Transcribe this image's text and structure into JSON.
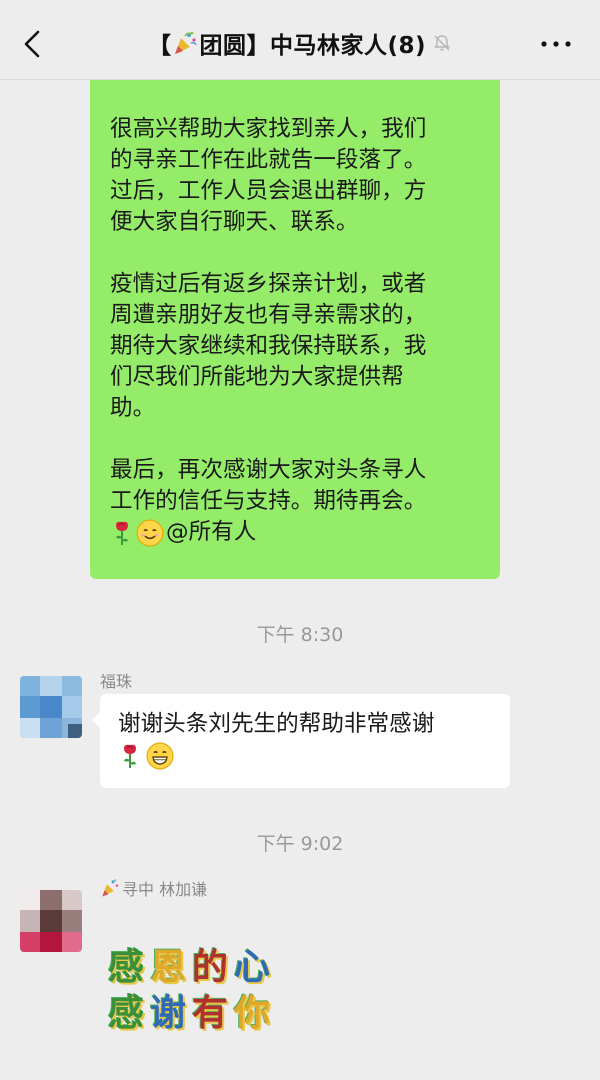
{
  "header": {
    "title_prefix": "【",
    "title_group": "团圆】中马林家人(8)"
  },
  "messages": {
    "bubble1": {
      "para1": "很高兴帮助大家找到亲人，我们\n的寻亲工作在此就告一段落了。\n过后，工作人员会退出群聊，方\n便大家自行聊天、联系。",
      "para2": "疫情过后有返乡探亲计划，或者\n周遭亲朋好友也有寻亲需求的，\n期待大家继续和我保持联系，我\n们尽我们所能地为大家提供帮\n助。",
      "para3": "最后，再次感谢大家对头条寻人\n工作的信任与支持。期待再会。",
      "mention": "@所有人"
    },
    "time1": "下午 8:30",
    "msg2": {
      "sender": "福珠",
      "text": "谢谢头条刘先生的帮助非常感谢"
    },
    "time2": "下午 9:02",
    "msg3": {
      "sender_prefix": "寻中 林加谦",
      "sticker_line1": [
        "感",
        "恩",
        "的",
        "心"
      ],
      "sticker_line2": [
        "感",
        "谢",
        "有",
        "你"
      ]
    }
  },
  "colors": {
    "bubble_green": "#95ec69",
    "background": "#ededed"
  }
}
